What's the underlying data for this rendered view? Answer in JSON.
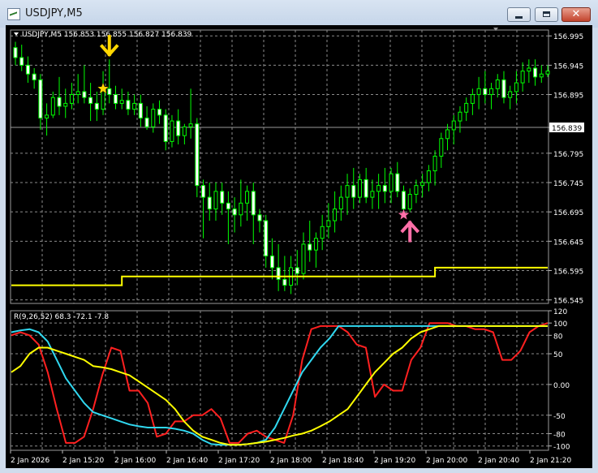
{
  "window": {
    "title": "USDJPY,M5",
    "minimize_label": "minimize",
    "maximize_label": "maximize",
    "close_label": "close"
  },
  "chart_data": [
    {
      "type": "candlestick",
      "header": "USDJPY,M5  156.853 156.855 156.827 156.839",
      "symbol": "USDJPY,M5",
      "ohlc_readout": [
        156.853,
        156.855,
        156.827,
        156.839
      ],
      "y_ticks": [
        "156.995",
        "156.945",
        "156.895",
        "156.839",
        "156.795",
        "156.745",
        "156.695",
        "156.645",
        "156.595",
        "156.545"
      ],
      "ylim": [
        156.539,
        157.005
      ],
      "current_price": 156.839,
      "colors": {
        "background": "#000000",
        "grid": "#8c8c8c",
        "candles": "#00ff00",
        "level_line": "#ffff00",
        "up_arrow": "#ff6fa8",
        "down_arrow": "#ffd700"
      },
      "candles": [
        [
          156.975,
          156.985,
          156.945,
          156.958
        ],
        [
          156.958,
          156.98,
          156.935,
          156.945
        ],
        [
          156.945,
          156.96,
          156.915,
          156.93
        ],
        [
          156.93,
          156.94,
          156.905,
          156.92
        ],
        [
          156.92,
          156.93,
          156.835,
          156.855
        ],
        [
          156.855,
          156.88,
          156.825,
          156.86
        ],
        [
          156.86,
          156.9,
          156.855,
          156.89
        ],
        [
          156.89,
          156.925,
          156.86,
          156.875
        ],
        [
          156.875,
          156.905,
          156.855,
          156.88
        ],
        [
          156.88,
          156.915,
          156.87,
          156.895
        ],
        [
          156.895,
          156.93,
          156.88,
          156.9
        ],
        [
          156.9,
          156.945,
          156.88,
          156.89
        ],
        [
          156.89,
          156.915,
          156.85,
          156.88
        ],
        [
          156.88,
          156.9,
          156.85,
          156.87
        ],
        [
          156.87,
          156.935,
          156.86,
          156.905
        ],
        [
          156.905,
          156.955,
          156.88,
          156.895
        ],
        [
          156.895,
          156.91,
          156.87,
          156.88
        ],
        [
          156.88,
          156.905,
          156.87,
          156.885
        ],
        [
          156.885,
          156.9,
          156.86,
          156.87
        ],
        [
          156.87,
          156.895,
          156.86,
          156.88
        ],
        [
          156.88,
          156.895,
          156.84,
          156.855
        ],
        [
          156.855,
          156.875,
          156.835,
          156.84
        ],
        [
          156.84,
          156.88,
          156.83,
          156.87
        ],
        [
          156.87,
          156.885,
          156.845,
          156.86
        ],
        [
          156.86,
          156.87,
          156.8,
          156.815
        ],
        [
          156.815,
          156.86,
          156.805,
          156.85
        ],
        [
          156.85,
          156.87,
          156.81,
          156.825
        ],
        [
          156.825,
          156.845,
          156.81,
          156.84
        ],
        [
          156.84,
          156.905,
          156.82,
          156.845
        ],
        [
          156.845,
          156.855,
          156.72,
          156.74
        ],
        [
          156.74,
          156.75,
          156.65,
          156.72
        ],
        [
          156.72,
          156.745,
          156.68,
          156.7
        ],
        [
          156.7,
          156.745,
          156.68,
          156.73
        ],
        [
          156.73,
          156.745,
          156.69,
          156.71
        ],
        [
          156.71,
          156.73,
          156.64,
          156.7
        ],
        [
          156.7,
          156.72,
          156.66,
          156.69
        ],
        [
          156.69,
          156.75,
          156.67,
          156.71
        ],
        [
          156.71,
          156.74,
          156.68,
          156.73
        ],
        [
          156.73,
          156.745,
          156.64,
          156.69
        ],
        [
          156.69,
          156.7,
          156.66,
          156.68
        ],
        [
          156.68,
          156.69,
          156.6,
          156.62
        ],
        [
          156.62,
          156.65,
          156.58,
          156.6
        ],
        [
          156.6,
          156.64,
          156.56,
          156.58
        ],
        [
          156.58,
          156.62,
          156.56,
          156.57
        ],
        [
          156.57,
          156.62,
          156.555,
          156.6
        ],
        [
          156.6,
          156.63,
          156.57,
          156.59
        ],
        [
          156.59,
          156.66,
          156.58,
          156.64
        ],
        [
          156.64,
          156.68,
          156.61,
          156.63
        ],
        [
          156.63,
          156.66,
          156.6,
          156.65
        ],
        [
          156.65,
          156.69,
          156.63,
          156.67
        ],
        [
          156.67,
          156.71,
          156.65,
          156.68
        ],
        [
          156.68,
          156.73,
          156.66,
          156.7
        ],
        [
          156.7,
          156.74,
          156.68,
          156.72
        ],
        [
          156.72,
          156.76,
          156.69,
          156.74
        ],
        [
          156.74,
          156.77,
          156.7,
          156.72
        ],
        [
          156.72,
          156.76,
          156.71,
          156.75
        ],
        [
          156.75,
          156.77,
          156.71,
          156.72
        ],
        [
          156.72,
          156.75,
          156.7,
          156.73
        ],
        [
          156.73,
          156.76,
          156.7,
          156.74
        ],
        [
          156.74,
          156.77,
          156.71,
          156.73
        ],
        [
          156.73,
          156.77,
          156.71,
          156.76
        ],
        [
          156.76,
          156.78,
          156.72,
          156.73
        ],
        [
          156.73,
          156.74,
          156.69,
          156.7
        ],
        [
          156.7,
          156.735,
          156.695,
          156.725
        ],
        [
          156.725,
          156.75,
          156.71,
          156.74
        ],
        [
          156.74,
          156.76,
          156.72,
          156.745
        ],
        [
          156.745,
          156.775,
          156.73,
          156.765
        ],
        [
          156.765,
          156.8,
          156.74,
          156.79
        ],
        [
          156.79,
          156.83,
          156.77,
          156.82
        ],
        [
          156.82,
          156.845,
          156.8,
          156.835
        ],
        [
          156.835,
          156.86,
          156.81,
          156.85
        ],
        [
          156.85,
          156.875,
          156.83,
          156.865
        ],
        [
          156.865,
          156.89,
          156.85,
          156.88
        ],
        [
          156.88,
          156.905,
          156.86,
          156.895
        ],
        [
          156.895,
          156.925,
          156.87,
          156.905
        ],
        [
          156.905,
          156.935,
          156.88,
          156.895
        ],
        [
          156.895,
          156.915,
          156.87,
          156.905
        ],
        [
          156.905,
          156.93,
          156.89,
          156.92
        ],
        [
          156.92,
          156.935,
          156.88,
          156.89
        ],
        [
          156.89,
          156.91,
          156.87,
          156.9
        ],
        [
          156.9,
          156.935,
          156.88,
          156.915
        ],
        [
          156.915,
          156.95,
          156.9,
          156.935
        ],
        [
          156.935,
          156.955,
          156.915,
          156.94
        ],
        [
          156.94,
          156.955,
          156.91,
          156.925
        ],
        [
          156.925,
          156.945,
          156.915,
          156.93
        ],
        [
          156.93,
          156.945,
          156.925,
          156.935
        ]
      ],
      "level_line": [
        {
          "from": 0,
          "to": 17,
          "value": 156.57
        },
        {
          "from": 17,
          "to": 67,
          "value": 156.585
        },
        {
          "from": 67,
          "to": 86,
          "value": 156.6
        }
      ],
      "markers": [
        {
          "type": "arrow-down",
          "index": 15,
          "value": 156.98,
          "color": "#ffd700"
        },
        {
          "type": "star",
          "index": 14,
          "value": 156.905,
          "color": "#ffd700"
        },
        {
          "type": "star",
          "index": 62,
          "value": 156.69,
          "color": "#ff6fa8"
        },
        {
          "type": "arrow-up",
          "index": 63,
          "value": 156.66,
          "color": "#ff6fa8"
        }
      ]
    },
    {
      "type": "line",
      "header": "R(9,26,52) 68.3 -72.1 -7.8",
      "name": "R(9,26,52)",
      "readout": [
        68.3,
        -72.1,
        -7.8
      ],
      "y_ticks": [
        "120",
        "100",
        "80",
        "50",
        "0.00",
        "-50",
        "-80",
        "-100"
      ],
      "ylim": [
        -107,
        120
      ],
      "x_labels": [
        "2 Jan 2026",
        "2 Jan 15:20",
        "2 Jan 16:00",
        "2 Jan 16:40",
        "2 Jan 17:20",
        "2 Jan 18:00",
        "2 Jan 18:40",
        "2 Jan 19:20",
        "2 Jan 20:00",
        "2 Jan 20:40",
        "2 Jan 21:20"
      ],
      "series": [
        {
          "color": "#ff2020",
          "values": [
            80,
            85,
            80,
            65,
            20,
            -40,
            -95,
            -95,
            -85,
            -40,
            15,
            60,
            55,
            -10,
            -10,
            -30,
            -85,
            -80,
            -60,
            -60,
            -50,
            -50,
            -40,
            -55,
            -95,
            -95,
            -80,
            -75,
            -85,
            -90,
            -95,
            -50,
            40,
            90,
            95,
            95,
            95,
            85,
            65,
            60,
            -20,
            0,
            -10,
            -10,
            40,
            60,
            100,
            100,
            100,
            95,
            95,
            90,
            90,
            85,
            40,
            40,
            55,
            85,
            95,
            100
          ]
        },
        {
          "color": "#30d8f0",
          "values": [
            85,
            88,
            90,
            85,
            70,
            40,
            10,
            -10,
            -30,
            -45,
            -50,
            -55,
            -60,
            -65,
            -68,
            -70,
            -70,
            -70,
            -72,
            -75,
            -80,
            -90,
            -97,
            -98,
            -98,
            -98,
            -97,
            -95,
            -90,
            -70,
            -40,
            -10,
            20,
            40,
            60,
            75,
            95,
            95,
            95,
            95,
            95,
            95,
            95,
            95,
            95,
            95,
            95,
            95,
            95,
            95,
            95,
            95,
            95,
            95,
            95,
            95,
            95,
            95,
            95,
            95
          ]
        },
        {
          "color": "#ffff00",
          "values": [
            20,
            30,
            50,
            60,
            60,
            55,
            50,
            45,
            40,
            30,
            28,
            25,
            20,
            15,
            5,
            -5,
            -15,
            -25,
            -40,
            -60,
            -75,
            -85,
            -90,
            -95,
            -98,
            -98,
            -97,
            -95,
            -93,
            -90,
            -87,
            -83,
            -80,
            -75,
            -68,
            -60,
            -50,
            -40,
            -20,
            0,
            20,
            35,
            50,
            60,
            75,
            85,
            90,
            95,
            95,
            95,
            95,
            95,
            95,
            95,
            95,
            95,
            95,
            95,
            95,
            95
          ]
        }
      ]
    }
  ]
}
